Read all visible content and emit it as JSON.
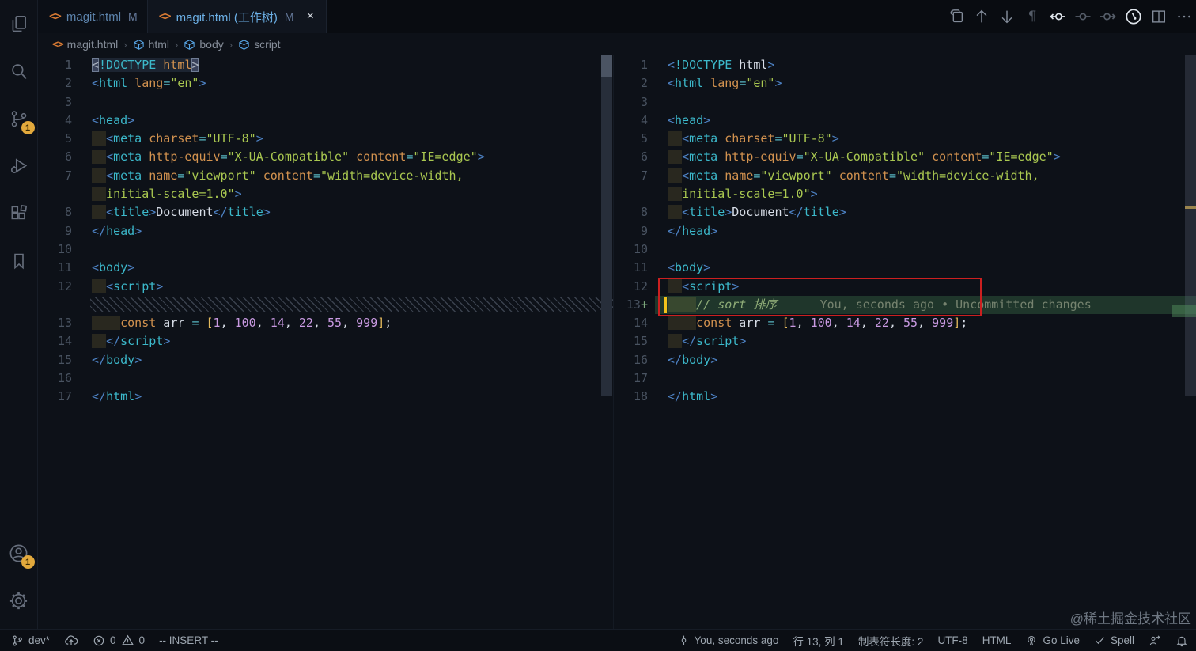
{
  "tabs": [
    {
      "label": "magit.html",
      "modified": "M",
      "active": false
    },
    {
      "label": "magit.html (工作树)",
      "modified": "M",
      "active": true,
      "close": "×"
    }
  ],
  "breadcrumb": {
    "items": [
      "magit.html",
      "html",
      "body",
      "script"
    ],
    "separator": "›"
  },
  "activity_bar": {
    "items": [
      {
        "name": "explorer"
      },
      {
        "name": "search"
      },
      {
        "name": "source-control",
        "badge": "1"
      },
      {
        "name": "run-debug"
      },
      {
        "name": "extensions"
      },
      {
        "name": "bookmarks"
      }
    ],
    "bottom": [
      {
        "name": "account",
        "badge": "1"
      },
      {
        "name": "settings"
      }
    ],
    "badges": {
      "source_control": "1",
      "account": "1"
    }
  },
  "colors": {
    "accent_blue": "#6cb0e6",
    "added_green": "#4a8e58",
    "annotation_red": "#cb2020",
    "cursor_yellow": "#f2c21b",
    "badge_orange": "#e2a93c"
  },
  "diff": {
    "blame_annotation": "You, seconds ago • Uncommitted changes"
  },
  "editors": {
    "left": {
      "lines": [
        {
          "n": "1",
          "selbg": true,
          "r": [
            [
              "brkm",
              "<"
            ],
            [
              "t",
              "!DOCTYPE"
            ],
            [
              "a",
              " html"
            ],
            [
              "brkm",
              ">"
            ]
          ]
        },
        {
          "n": "2",
          "r": [
            [
              "p",
              "<"
            ],
            [
              "t",
              "html"
            ],
            [
              "a",
              " lang"
            ],
            [
              "o",
              "="
            ],
            [
              "s",
              "\"en\""
            ],
            [
              "p",
              ">"
            ]
          ]
        },
        {
          "n": "3",
          "r": []
        },
        {
          "n": "4",
          "r": [
            [
              "p",
              "<"
            ],
            [
              "t",
              "head"
            ],
            [
              "p",
              ">"
            ]
          ]
        },
        {
          "n": "5",
          "r": [
            [
              "ind",
              "  "
            ],
            [
              "p",
              "<"
            ],
            [
              "t",
              "meta"
            ],
            [
              "a",
              " charset"
            ],
            [
              "o",
              "="
            ],
            [
              "s",
              "\"UTF-8\""
            ],
            [
              "p",
              ">"
            ]
          ]
        },
        {
          "n": "6",
          "r": [
            [
              "ind",
              "  "
            ],
            [
              "p",
              "<"
            ],
            [
              "t",
              "meta"
            ],
            [
              "a",
              " http-equiv"
            ],
            [
              "o",
              "="
            ],
            [
              "s",
              "\"X-UA-Compatible\""
            ],
            [
              "a",
              " content"
            ],
            [
              "o",
              "="
            ],
            [
              "s",
              "\"IE=edge\""
            ],
            [
              "p",
              ">"
            ]
          ]
        },
        {
          "n": "7",
          "r": [
            [
              "ind",
              "  "
            ],
            [
              "p",
              "<"
            ],
            [
              "t",
              "meta"
            ],
            [
              "a",
              " name"
            ],
            [
              "o",
              "="
            ],
            [
              "s",
              "\"viewport\""
            ],
            [
              "a",
              " content"
            ],
            [
              "o",
              "="
            ],
            [
              "s",
              "\"width=device-width,"
            ]
          ]
        },
        {
          "n": "",
          "r": [
            [
              "ind",
              "  "
            ],
            [
              "s",
              "initial-scale=1.0\""
            ],
            [
              "p",
              ">"
            ]
          ]
        },
        {
          "n": "8",
          "r": [
            [
              "ind",
              "  "
            ],
            [
              "p",
              "<"
            ],
            [
              "t",
              "title"
            ],
            [
              "p",
              ">"
            ],
            [
              "x",
              "Document"
            ],
            [
              "p",
              "</"
            ],
            [
              "t",
              "title"
            ],
            [
              "p",
              ">"
            ]
          ]
        },
        {
          "n": "9",
          "r": [
            [
              "p",
              "</"
            ],
            [
              "t",
              "head"
            ],
            [
              "p",
              ">"
            ]
          ]
        },
        {
          "n": "10",
          "r": []
        },
        {
          "n": "11",
          "r": [
            [
              "p",
              "<"
            ],
            [
              "t",
              "body"
            ],
            [
              "p",
              ">"
            ]
          ]
        },
        {
          "n": "12",
          "r": [
            [
              "ind",
              "  "
            ],
            [
              "p",
              "<"
            ],
            [
              "t",
              "script"
            ],
            [
              "p",
              ">"
            ]
          ]
        },
        {
          "hatch": true
        },
        {
          "n": "13",
          "r": [
            [
              "ind",
              "    "
            ],
            [
              "k",
              "const"
            ],
            [
              "x",
              " arr "
            ],
            [
              "o",
              "="
            ],
            [
              "x",
              " "
            ],
            [
              "b",
              "["
            ],
            [
              "n2",
              "1"
            ],
            [
              "x",
              ", "
            ],
            [
              "n2",
              "100"
            ],
            [
              "x",
              ", "
            ],
            [
              "n2",
              "14"
            ],
            [
              "x",
              ", "
            ],
            [
              "n2",
              "22"
            ],
            [
              "x",
              ", "
            ],
            [
              "n2",
              "55"
            ],
            [
              "x",
              ", "
            ],
            [
              "n2",
              "999"
            ],
            [
              "b",
              "]"
            ],
            [
              "x",
              ";"
            ]
          ]
        },
        {
          "n": "14",
          "r": [
            [
              "ind",
              "  "
            ],
            [
              "p",
              "</"
            ],
            [
              "t",
              "script"
            ],
            [
              "p",
              ">"
            ]
          ]
        },
        {
          "n": "15",
          "r": [
            [
              "p",
              "</"
            ],
            [
              "t",
              "body"
            ],
            [
              "p",
              ">"
            ]
          ]
        },
        {
          "n": "16",
          "r": []
        },
        {
          "n": "17",
          "r": [
            [
              "p",
              "</"
            ],
            [
              "t",
              "html"
            ],
            [
              "p",
              ">"
            ]
          ]
        }
      ]
    },
    "right": {
      "lines": [
        {
          "n": "1",
          "r": [
            [
              "p",
              "<"
            ],
            [
              "t",
              "!DOCTYPE"
            ],
            [
              "x",
              " html"
            ],
            [
              "p",
              ">"
            ]
          ]
        },
        {
          "n": "2",
          "r": [
            [
              "p",
              "<"
            ],
            [
              "t",
              "html"
            ],
            [
              "a",
              " lang"
            ],
            [
              "o",
              "="
            ],
            [
              "s",
              "\"en\""
            ],
            [
              "p",
              ">"
            ]
          ]
        },
        {
          "n": "3",
          "r": []
        },
        {
          "n": "4",
          "r": [
            [
              "p",
              "<"
            ],
            [
              "t",
              "head"
            ],
            [
              "p",
              ">"
            ]
          ]
        },
        {
          "n": "5",
          "r": [
            [
              "ind",
              "  "
            ],
            [
              "p",
              "<"
            ],
            [
              "t",
              "meta"
            ],
            [
              "a",
              " charset"
            ],
            [
              "o",
              "="
            ],
            [
              "s",
              "\"UTF-8\""
            ],
            [
              "p",
              ">"
            ]
          ]
        },
        {
          "n": "6",
          "r": [
            [
              "ind",
              "  "
            ],
            [
              "p",
              "<"
            ],
            [
              "t",
              "meta"
            ],
            [
              "a",
              " http-equiv"
            ],
            [
              "o",
              "="
            ],
            [
              "s",
              "\"X-UA-Compatible\""
            ],
            [
              "a",
              " content"
            ],
            [
              "o",
              "="
            ],
            [
              "s",
              "\"IE=edge\""
            ],
            [
              "p",
              ">"
            ]
          ]
        },
        {
          "n": "7",
          "r": [
            [
              "ind",
              "  "
            ],
            [
              "p",
              "<"
            ],
            [
              "t",
              "meta"
            ],
            [
              "a",
              " name"
            ],
            [
              "o",
              "="
            ],
            [
              "s",
              "\"viewport\""
            ],
            [
              "a",
              " content"
            ],
            [
              "o",
              "="
            ],
            [
              "s",
              "\"width=device-width,"
            ]
          ]
        },
        {
          "n": "",
          "r": [
            [
              "ind",
              "  "
            ],
            [
              "s",
              "initial-scale=1.0\""
            ],
            [
              "p",
              ">"
            ]
          ]
        },
        {
          "n": "8",
          "r": [
            [
              "ind",
              "  "
            ],
            [
              "p",
              "<"
            ],
            [
              "t",
              "title"
            ],
            [
              "p",
              ">"
            ],
            [
              "x",
              "Document"
            ],
            [
              "p",
              "</"
            ],
            [
              "t",
              "title"
            ],
            [
              "p",
              ">"
            ]
          ]
        },
        {
          "n": "9",
          "r": [
            [
              "p",
              "</"
            ],
            [
              "t",
              "head"
            ],
            [
              "p",
              ">"
            ]
          ]
        },
        {
          "n": "10",
          "r": []
        },
        {
          "n": "11",
          "r": [
            [
              "p",
              "<"
            ],
            [
              "t",
              "body"
            ],
            [
              "p",
              ">"
            ]
          ]
        },
        {
          "n": "12",
          "r": [
            [
              "ind",
              "  "
            ],
            [
              "p",
              "<"
            ],
            [
              "t",
              "script"
            ],
            [
              "p",
              ">"
            ]
          ]
        },
        {
          "n": "13",
          "plus": "+",
          "added": true,
          "cursor": true,
          "r": [
            [
              "ind",
              "    "
            ],
            [
              "c",
              "// sort 排序"
            ],
            [
              "x",
              "      "
            ],
            [
              "g",
              "You, seconds ago • Uncommitted changes"
            ]
          ]
        },
        {
          "n": "14",
          "r": [
            [
              "ind",
              "    "
            ],
            [
              "k",
              "const"
            ],
            [
              "x",
              " arr "
            ],
            [
              "o",
              "="
            ],
            [
              "x",
              " "
            ],
            [
              "b",
              "["
            ],
            [
              "n2",
              "1"
            ],
            [
              "x",
              ", "
            ],
            [
              "n2",
              "100"
            ],
            [
              "x",
              ", "
            ],
            [
              "n2",
              "14"
            ],
            [
              "x",
              ", "
            ],
            [
              "n2",
              "22"
            ],
            [
              "x",
              ", "
            ],
            [
              "n2",
              "55"
            ],
            [
              "x",
              ", "
            ],
            [
              "n2",
              "999"
            ],
            [
              "b",
              "]"
            ],
            [
              "x",
              ";"
            ]
          ]
        },
        {
          "n": "15",
          "r": [
            [
              "ind",
              "  "
            ],
            [
              "p",
              "</"
            ],
            [
              "t",
              "script"
            ],
            [
              "p",
              ">"
            ]
          ]
        },
        {
          "n": "16",
          "r": [
            [
              "p",
              "</"
            ],
            [
              "t",
              "body"
            ],
            [
              "p",
              ">"
            ]
          ]
        },
        {
          "n": "17",
          "r": []
        },
        {
          "n": "18",
          "r": [
            [
              "p",
              "</"
            ],
            [
              "t",
              "html"
            ],
            [
              "p",
              ">"
            ]
          ]
        }
      ]
    }
  },
  "status_bar": {
    "branch": "dev*",
    "errors": "0",
    "warnings": "0",
    "mode": "-- INSERT --",
    "blame": "You, seconds ago",
    "cursor_position": "行 13,  列 1",
    "tab_size": "制表符长度: 2",
    "encoding": "UTF-8",
    "language": "HTML",
    "go_live": "Go Live",
    "spell": "Spell"
  },
  "watermark": "@稀土掘金技术社区"
}
